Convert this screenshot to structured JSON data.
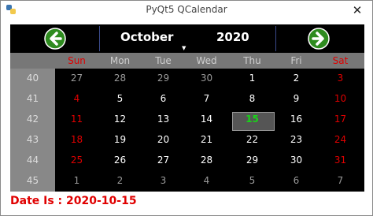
{
  "window": {
    "title": "PyQt5 QCalendar",
    "close_glyph": "✕",
    "app_icon": "python-icon"
  },
  "calendar": {
    "nav": {
      "prev_icon": "left-arrow-icon",
      "next_icon": "right-arrow-icon",
      "month": "October",
      "year": "2020",
      "caret": "▼"
    },
    "weekdays": [
      "Sun",
      "Mon",
      "Tue",
      "Wed",
      "Thu",
      "Fri",
      "Sat"
    ],
    "weekend_color": "#e00000",
    "week_numbers": [
      "40",
      "41",
      "42",
      "43",
      "44",
      "45"
    ],
    "weeks": [
      [
        "27",
        "28",
        "29",
        "30",
        "1",
        "2",
        "3"
      ],
      [
        "4",
        "5",
        "6",
        "7",
        "8",
        "9",
        "10"
      ],
      [
        "11",
        "12",
        "13",
        "14",
        "15",
        "16",
        "17"
      ],
      [
        "18",
        "19",
        "20",
        "21",
        "22",
        "23",
        "24"
      ],
      [
        "25",
        "26",
        "27",
        "28",
        "29",
        "30",
        "31"
      ],
      [
        "1",
        "2",
        "3",
        "4",
        "5",
        "6",
        "7"
      ]
    ],
    "selected": "15",
    "selected_color": "#17d417"
  },
  "status": {
    "date_label": "Date Is : 2020-10-15"
  }
}
